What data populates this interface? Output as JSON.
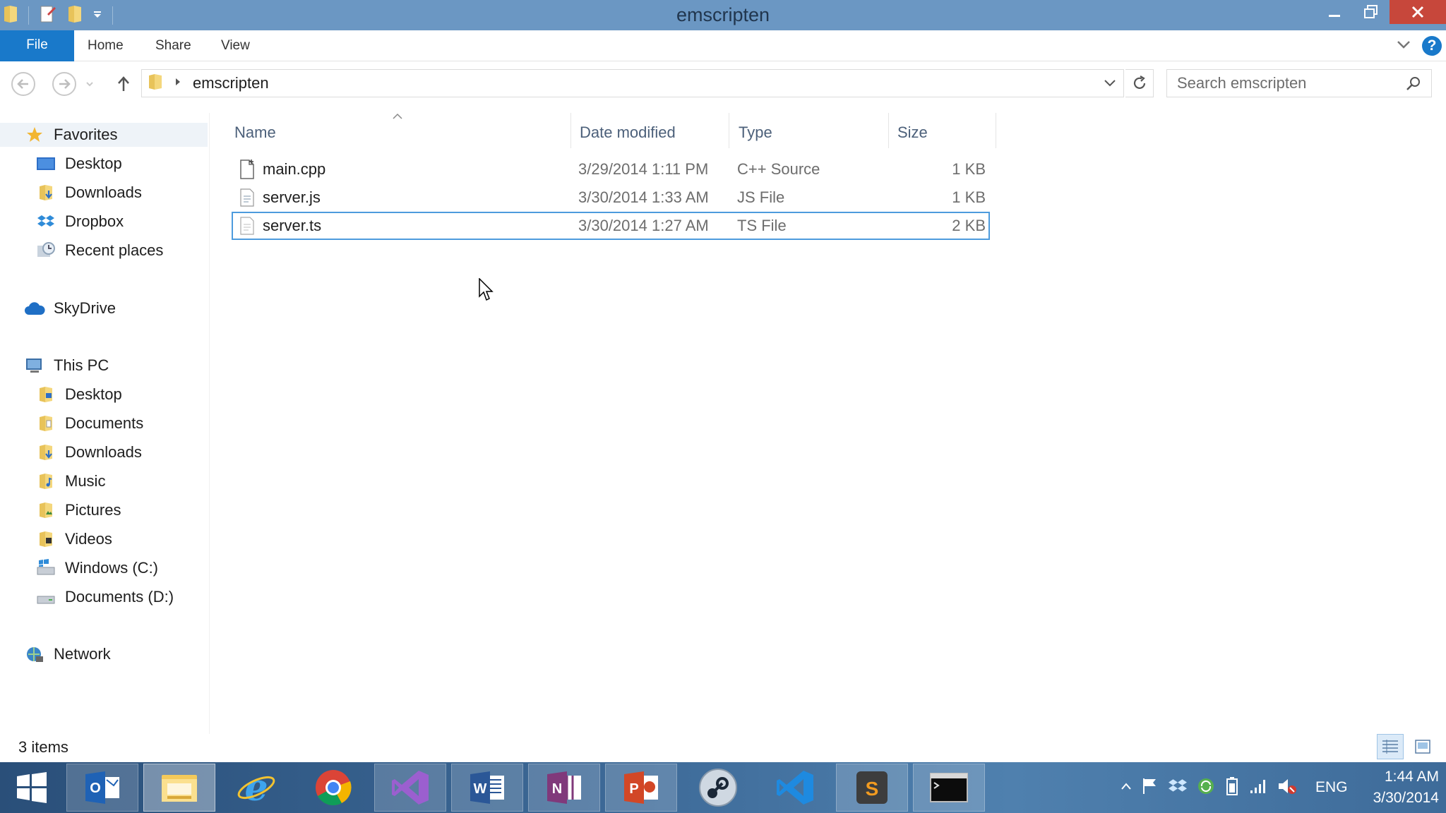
{
  "window": {
    "title": "emscripten"
  },
  "ribbon": {
    "tabs": [
      "File",
      "Home",
      "Share",
      "View"
    ]
  },
  "address": {
    "crumb": "emscripten",
    "search_placeholder": "Search emscripten"
  },
  "nav": {
    "favorites": "Favorites",
    "fav_items": [
      "Desktop",
      "Downloads",
      "Dropbox",
      "Recent places"
    ],
    "skydrive": "SkyDrive",
    "thispc": "This PC",
    "pc_items": [
      "Desktop",
      "Documents",
      "Downloads",
      "Music",
      "Pictures",
      "Videos",
      "Windows (C:)",
      "Documents (D:)"
    ],
    "network": "Network"
  },
  "columns": {
    "name": "Name",
    "date": "Date modified",
    "type": "Type",
    "size": "Size"
  },
  "files": [
    {
      "name": "main.cpp",
      "date": "3/29/2014 1:11 PM",
      "type": "C++ Source",
      "size": "1 KB"
    },
    {
      "name": "server.js",
      "date": "3/30/2014 1:33 AM",
      "type": "JS File",
      "size": "1 KB"
    },
    {
      "name": "server.ts",
      "date": "3/30/2014 1:27 AM",
      "type": "TS File",
      "size": "2 KB",
      "selected": true
    }
  ],
  "status": {
    "count": "3 items"
  },
  "taskbar": {
    "apps": [
      "start-icon",
      "outlook-icon",
      "file-explorer-icon",
      "internet-explorer-icon",
      "chrome-icon",
      "visual-studio-icon",
      "word-icon",
      "onenote-icon",
      "powerpoint-icon",
      "steam-icon",
      "vscode-icon",
      "sublime-text-icon",
      "command-prompt-icon"
    ],
    "lang": "ENG",
    "time": "1:44 AM",
    "date": "3/30/2014"
  },
  "colors": {
    "accent": "#1979ca",
    "titlebar": "#6b97c3",
    "close": "#c7473b",
    "selection": "#4d9bdd"
  }
}
